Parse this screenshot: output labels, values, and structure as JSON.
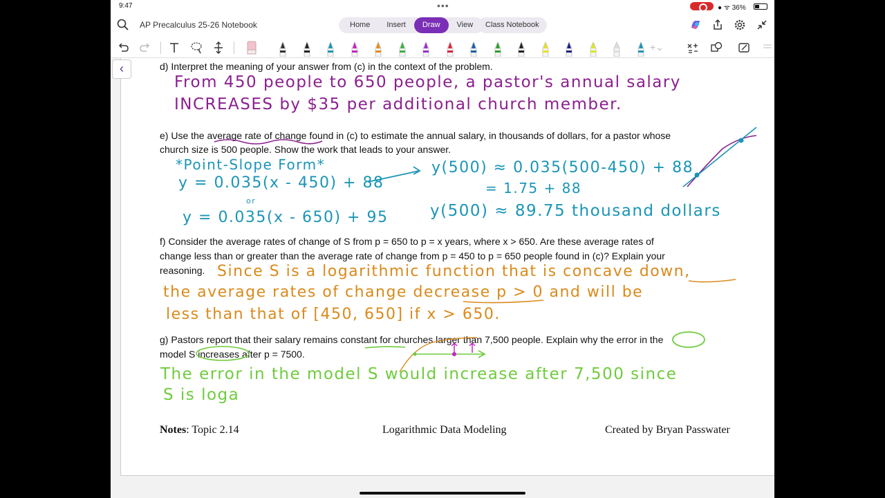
{
  "status": {
    "time": "9:47",
    "battery": "36%"
  },
  "titlebar": {
    "notebook_title": "AP Precalculus 25-26 Notebook",
    "tabs": [
      "Home",
      "Insert",
      "Draw",
      "View"
    ],
    "class_notebook": "Class Notebook"
  },
  "accent": "#7a2fb6",
  "pens": [
    "#333333",
    "#222222",
    "#1b95b6",
    "#c026c0",
    "#e88a1a",
    "#3cb043",
    "#9b2fc6",
    "#d6283a",
    "#1a5fa8",
    "#2ca02c",
    "#222222",
    "#e8e01a",
    "#1a237e",
    "#d7e820",
    "#dddddd",
    "#1b95b6"
  ],
  "doc": {
    "q_d": "d)  Interpret the meaning of your answer from (c) in the context of the problem.",
    "ans_d1": "From 450 people to 650 people, a pastor's annual salary",
    "ans_d2": "INCREASES by $35 per additional church member.",
    "q_e1": "e)  Use the average rate of change found in (c) to estimate the annual salary, in thousands of dollars, for a pastor whose",
    "q_e2": "church size is 500 people.  Show the work that leads to your answer.",
    "ans_e_form": "*Point-Slope Form*",
    "ans_e_eq1": "y = 0.035(x - 450) + 88",
    "ans_e_or": "or",
    "ans_e_eq2": "y = 0.035(x - 650) + 95",
    "ans_e_sub": "y(500) ≈ 0.035(500-450) + 88",
    "ans_e_step": "= 1.75 + 88",
    "ans_e_result": "y(500) ≈ 89.75 thousand dollars",
    "q_f1": "f)  Consider the average rates of change of S from p = 650 to p = x years, where x > 650.  Are these average rates of",
    "q_f2": "change less than or greater than the average rate of change from p = 450 to p = 650 people found in (c)?  Explain your",
    "q_f3": "reasoning.",
    "ans_f1": "Since S is a logarithmic function that is concave down,",
    "ans_f2": "the average rates of change decrease p > 0 and will be",
    "ans_f3": "less than that of [450, 650] if x > 650.",
    "q_g1": "g)  Pastors report that their salary remains constant for churches larger than 7,500 people.  Explain why the error in the",
    "q_g2": "model S increases after p = 7500.",
    "ans_g1": "The error in the model S would increase after 7,500 since",
    "ans_g2": "S is loga",
    "footer_left_bold": "Notes",
    "footer_left": ": Topic 2.14",
    "footer_center": "Logarithmic Data Modeling",
    "footer_right": "Created by Bryan Passwater"
  }
}
